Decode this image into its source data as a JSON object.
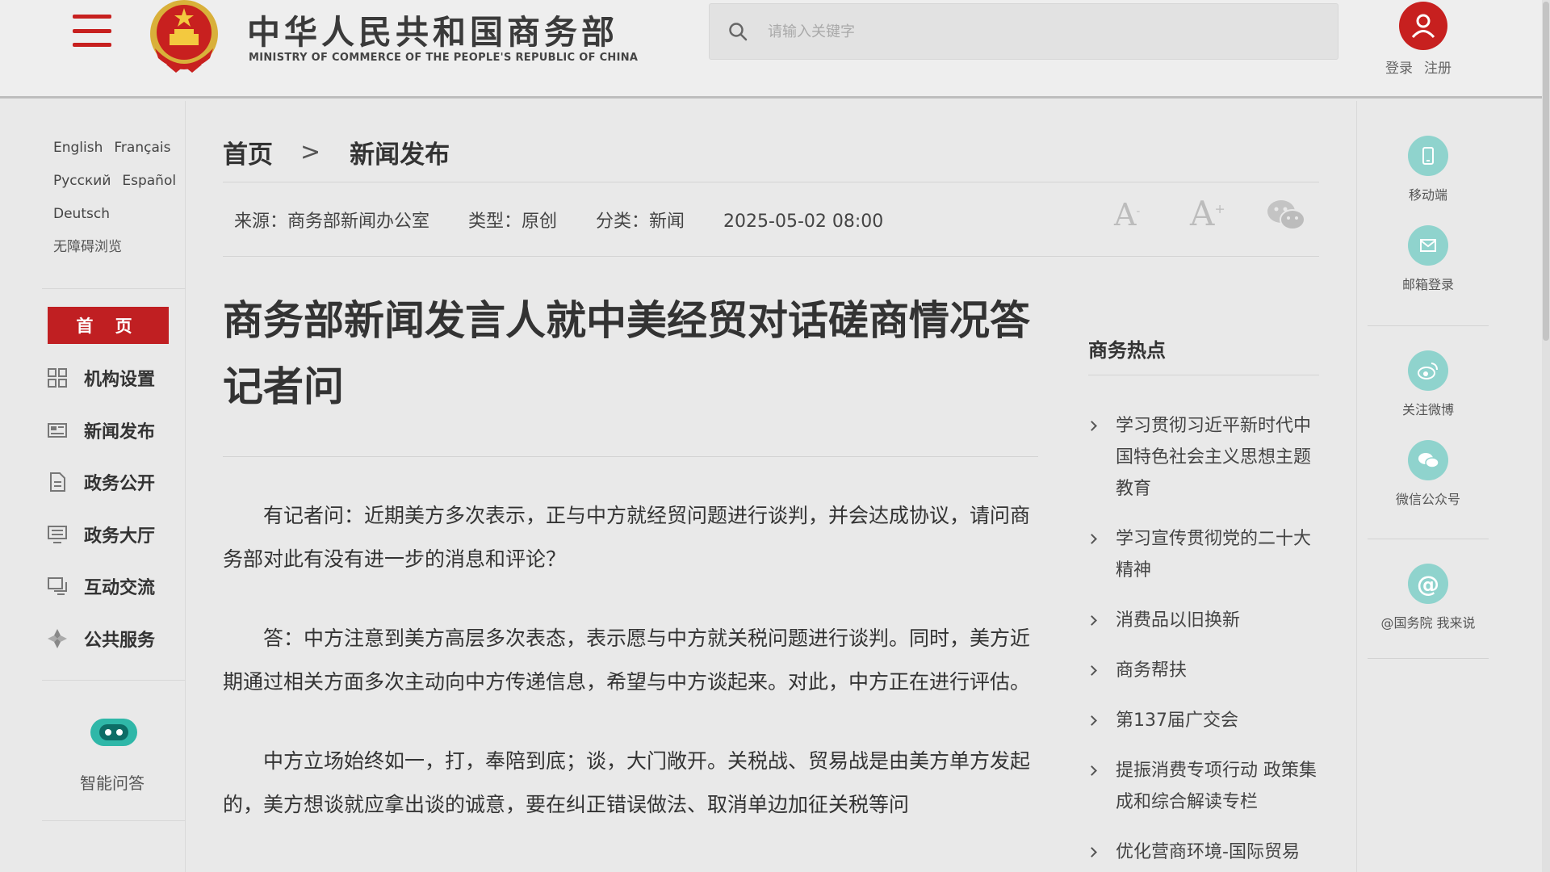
{
  "header": {
    "menu_icon": "hamburger-menu-icon",
    "emblem_icon": "national-emblem-icon",
    "site_name_cn": "中华人民共和国商务部",
    "site_name_en": "MINISTRY OF COMMERCE OF THE PEOPLE'S REPUBLIC OF CHINA",
    "search_placeholder": "请输入关键字",
    "search_icon": "search-icon",
    "user_icon": "user-icon",
    "login_label": "登录",
    "register_label": "注册",
    "accent_color": "#c7201f"
  },
  "left_sidebar": {
    "languages": [
      "English",
      "Français",
      "Русский",
      "Español",
      "Deutsch"
    ],
    "accessibility_label": "无障碍浏览",
    "home_label": "首 页",
    "nav_items": [
      {
        "label": "机构设置",
        "icon": "grid-icon"
      },
      {
        "label": "新闻发布",
        "icon": "newspaper-icon"
      },
      {
        "label": "政务公开",
        "icon": "document-icon"
      },
      {
        "label": "政务大厅",
        "icon": "monitor-icon"
      },
      {
        "label": "互动交流",
        "icon": "chat-icon"
      },
      {
        "label": "公共服务",
        "icon": "service-icon"
      }
    ],
    "assistant_icon": "robot-icon",
    "assistant_label": "智能问答"
  },
  "breadcrumb": {
    "home": "首页",
    "separator": ">",
    "current": "新闻发布"
  },
  "meta": {
    "source": "来源：商务部新闻办公室",
    "type": "类型：原创",
    "category": "分类：新闻",
    "datetime": "2025-05-02 08:00",
    "font_small_label": "A",
    "font_large_label": "A",
    "share_icon": "wechat-icon"
  },
  "article": {
    "title": "商务部新闻发言人就中美经贸对话磋商情况答记者问",
    "paragraphs": [
      "有记者问：近期美方多次表示，正与中方就经贸问题进行谈判，并会达成协议，请问商务部对此有没有进一步的消息和评论？",
      "答：中方注意到美方高层多次表态，表示愿与中方就关税问题进行谈判。同时，美方近期通过相关方面多次主动向中方传递信息，希望与中方谈起来。对此，中方正在进行评估。",
      "中方立场始终如一，打，奉陪到底；谈，大门敞开。关税战、贸易战是由美方单方发起的，美方想谈就应拿出谈的诚意，要在纠正错误做法、取消单边加征关税等问"
    ]
  },
  "hotspot": {
    "title": "商务热点",
    "items": [
      "学习贯彻习近平新时代中国特色社会主义思想主题教育",
      "学习宣传贯彻党的二十大精神",
      "消费品以旧换新",
      "商务帮扶",
      "第137届广交会",
      "提振消费专项行动 政策集成和综合解读专栏",
      "优化营商环境-国际贸易"
    ]
  },
  "right_sidebar": {
    "items": [
      {
        "label": "移动端",
        "icon": "mobile-icon"
      },
      {
        "label": "邮箱登录",
        "icon": "mail-icon"
      },
      {
        "label": "关注微博",
        "icon": "weibo-icon"
      },
      {
        "label": "微信公众号",
        "icon": "wechat-icon"
      },
      {
        "label": "@国务院 我来说",
        "icon": "at-icon"
      }
    ],
    "icon_color": "#8fd3cd"
  }
}
